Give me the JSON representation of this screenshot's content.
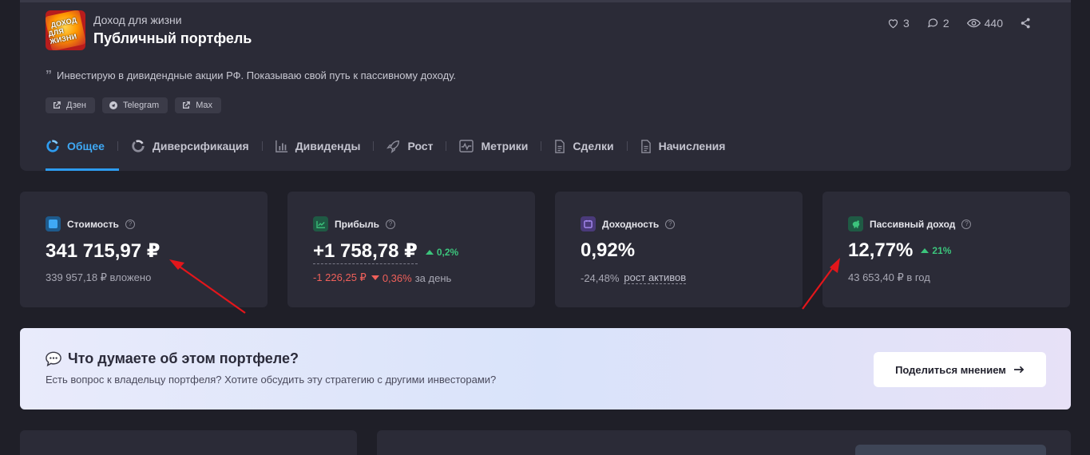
{
  "header": {
    "logo_text": [
      "ДОХОД",
      "ДЛЯ ЖИЗНИ"
    ],
    "subtitle": "Доход для жизни",
    "title": "Публичный портфель",
    "stats": {
      "likes": "3",
      "comments": "2",
      "views": "440"
    }
  },
  "description": "Инвестирую в дивидендные акции РФ. Показываю свой путь к пассивному доходу.",
  "links": [
    {
      "label": "Дзен"
    },
    {
      "label": "Telegram"
    },
    {
      "label": "Max"
    }
  ],
  "tabs": [
    {
      "label": "Общее",
      "active": true
    },
    {
      "label": "Диверсификация"
    },
    {
      "label": "Дивиденды"
    },
    {
      "label": "Рост"
    },
    {
      "label": "Метрики"
    },
    {
      "label": "Сделки"
    },
    {
      "label": "Начисления"
    }
  ],
  "cards": {
    "value": {
      "label": "Стоимость",
      "amount": "341 715,97 ₽",
      "sub": "339 957,18 ₽ вложено"
    },
    "profit": {
      "label": "Прибыль",
      "amount": "+1 758,78 ₽",
      "delta": "0,2%",
      "day_amount": "-1 226,25 ₽",
      "day_delta": "0,36%",
      "day_suffix": "за день"
    },
    "yield": {
      "label": "Доходность",
      "amount": "0,92%",
      "sub_value": "-24,48%",
      "sub_link": "рост активов"
    },
    "passive": {
      "label": "Пассивный доход",
      "amount": "12,77%",
      "delta": "21%",
      "sub": "43 653,40 ₽ в год"
    }
  },
  "banner": {
    "title": "Что думаете об этом портфеле?",
    "text": "Есть вопрос к владельцу портфеля? Хотите обсудить эту стратегию с другими инвесторами?",
    "button": "Поделиться мнением"
  },
  "colors": {
    "accent": "#2d9cf0",
    "positive": "#3cc47c",
    "negative": "#f0605a",
    "annotation_arrow": "#e3161b"
  }
}
